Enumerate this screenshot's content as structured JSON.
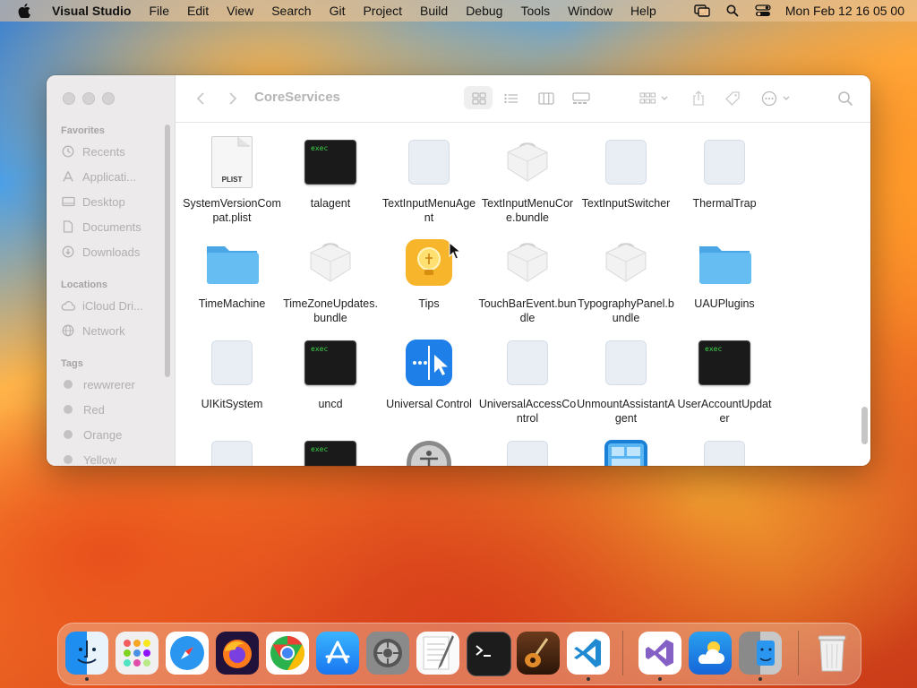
{
  "menubar": {
    "app_name": "Visual Studio",
    "items": [
      "File",
      "Edit",
      "View",
      "Search",
      "Git",
      "Project",
      "Build",
      "Debug",
      "Tools",
      "Window",
      "Help"
    ],
    "clock": "Mon Feb 12  16 05 00"
  },
  "finder": {
    "title": "CoreServices",
    "sidebar": {
      "favorites_header": "Favorites",
      "favorites": [
        "Recents",
        "Applicati...",
        "Desktop",
        "Documents",
        "Downloads"
      ],
      "locations_header": "Locations",
      "locations": [
        "iCloud Dri...",
        "Network"
      ],
      "tags_header": "Tags",
      "tags": [
        "rewwrerer",
        "Red",
        "Orange",
        "Yellow"
      ]
    },
    "items": [
      {
        "label": "SystemVersionCompat.plist",
        "icon": "plist-file-icon"
      },
      {
        "label": "talagent",
        "icon": "exec-icon"
      },
      {
        "label": "TextInputMenuAgent",
        "icon": "app-placeholder-icon"
      },
      {
        "label": "TextInputMenuCore.bundle",
        "icon": "bundle-icon"
      },
      {
        "label": "TextInputSwitcher",
        "icon": "app-placeholder-icon"
      },
      {
        "label": "ThermalTrap",
        "icon": "app-placeholder-icon"
      },
      {
        "label": "TimeMachine",
        "icon": "folder-icon"
      },
      {
        "label": "TimeZoneUpdates.bundle",
        "icon": "bundle-icon"
      },
      {
        "label": "Tips",
        "icon": "tips-app-icon"
      },
      {
        "label": "TouchBarEvent.bundle",
        "icon": "bundle-icon"
      },
      {
        "label": "TypographyPanel.bundle",
        "icon": "bundle-icon"
      },
      {
        "label": "UAUPlugins",
        "icon": "folder-icon"
      },
      {
        "label": "UIKitSystem",
        "icon": "app-placeholder-icon"
      },
      {
        "label": "uncd",
        "icon": "exec-icon"
      },
      {
        "label": "Universal Control",
        "icon": "universal-control-icon"
      },
      {
        "label": "UniversalAccessControl",
        "icon": "app-placeholder-icon"
      },
      {
        "label": "UnmountAssistantAgent",
        "icon": "app-placeholder-icon"
      },
      {
        "label": "UserAccountUpdater",
        "icon": "exec-icon"
      }
    ],
    "exec_text": "exec",
    "plist_text": "PLIST"
  },
  "dock": {
    "apps": [
      "finder",
      "launchpad",
      "safari",
      "firefox",
      "chrome",
      "app-store",
      "system-settings",
      "textedit",
      "terminal",
      "instruments",
      "vscode",
      "visual-studio",
      "weather",
      "migration-assistant",
      "trash"
    ]
  },
  "colors": {
    "folder_blue": "#5fb8ee",
    "exec_green": "#3fd14a",
    "tips_yellow": "#f7b52b",
    "universal_blue": "#1f7fe8"
  }
}
